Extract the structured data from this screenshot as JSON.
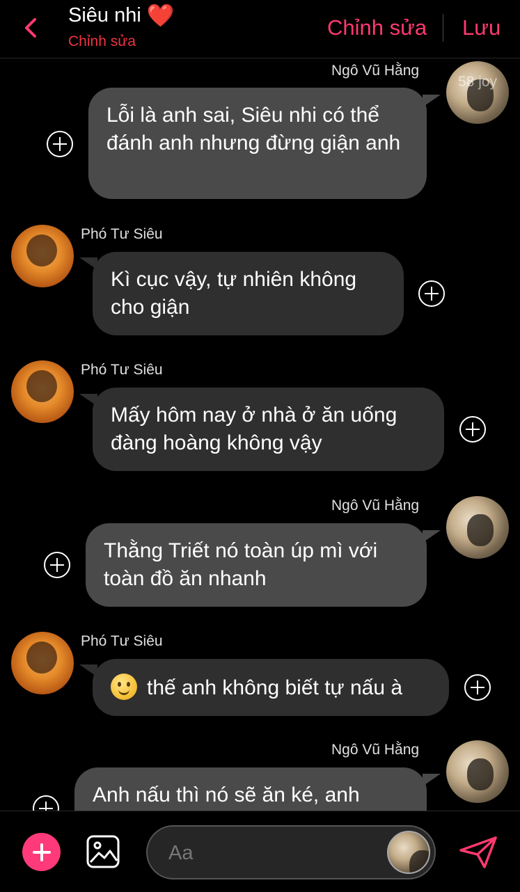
{
  "header": {
    "title": "Siêu nhi",
    "title_emoji": "❤️",
    "subtitle": "Chỉnh sửa",
    "edit_label": "Chỉnh sửa",
    "save_label": "Lưu",
    "accent_color": "#ff3a6e"
  },
  "watermark": "58 joy",
  "messages": [
    {
      "sender": "Ngô Vũ Hằng",
      "side": "right",
      "text": "Lỗi là anh sai, Siêu nhi có thể đánh anh nhưng đừng giận anh"
    },
    {
      "sender": "Phó Tư Siêu",
      "side": "left",
      "text": "Kì cục vậy, tự nhiên không cho giận"
    },
    {
      "sender": "Phó Tư Siêu",
      "side": "left",
      "text": "Mấy hôm nay ở nhà ở ăn uống đàng hoàng không vậy"
    },
    {
      "sender": "Ngô Vũ Hằng",
      "side": "right",
      "text": "Thằng Triết nó toàn úp mì với toàn đồ ăn nhanh"
    },
    {
      "sender": "Phó Tư Siêu",
      "side": "left",
      "emoji": "slightly-smiling-face",
      "text": "thế anh không biết tự nấu à"
    },
    {
      "sender": "Ngô Vũ Hằng",
      "side": "right",
      "text": "Anh nấu thì nó sẽ ăn ké, anh"
    }
  ],
  "composer": {
    "placeholder": "Aa",
    "add_icon": "plus-icon",
    "image_icon": "image-icon",
    "send_icon": "send-icon"
  }
}
